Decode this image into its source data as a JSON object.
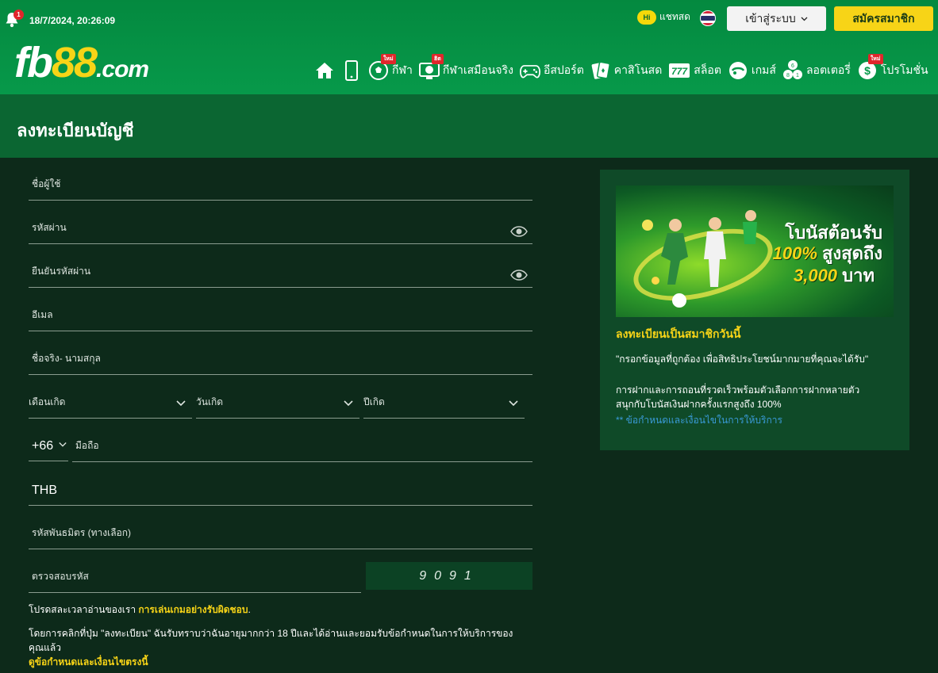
{
  "header": {
    "notification_count": "1",
    "datetime": "18/7/2024, 20:26:09",
    "chat_badge": "Hi",
    "chat_label": "แชทสด",
    "login_label": "เข้าสู่ระบบ",
    "register_label": "สมัครสมาชิก",
    "logo": {
      "part1": "fb",
      "part2": "88",
      "part3": ".com"
    },
    "nav": [
      {
        "icon": "home-icon",
        "label": "",
        "badge": ""
      },
      {
        "icon": "mobile-icon",
        "label": "",
        "badge": ""
      },
      {
        "icon": "soccer-ball-icon",
        "label": "กีฬา",
        "badge": "ใหม่"
      },
      {
        "icon": "virtual-sports-icon",
        "label": "กีฬาเสมือนจริง",
        "badge": "ฮิต"
      },
      {
        "icon": "gamepad-icon",
        "label": "อีสปอร์ต",
        "badge": ""
      },
      {
        "icon": "cards-icon",
        "label": "คาสิโนสด",
        "badge": ""
      },
      {
        "icon": "slot-777-icon",
        "label": "สล็อต",
        "badge": ""
      },
      {
        "icon": "game-icon",
        "label": "เกมส์",
        "badge": ""
      },
      {
        "icon": "lottery-balls-icon",
        "label": "ลอตเตอรี่",
        "badge": ""
      },
      {
        "icon": "promo-dollar-icon",
        "label": "โปรโมชั่น",
        "badge": "ใหม่"
      }
    ]
  },
  "page_title": "ลงทะเบียนบัญชี",
  "form": {
    "username_placeholder": "ชื่อผู้ใช้",
    "password_placeholder": "รหัสผ่าน",
    "confirm_password_placeholder": "ยืนยันรหัสผ่าน",
    "email_placeholder": "อีเมล",
    "fullname_placeholder": "ชื่อจริง- นามสกุล",
    "birth_month_label": "เดือนเกิด",
    "birth_day_label": "วันเกิด",
    "birth_year_label": "ปีเกิด",
    "phone_code": "+66",
    "phone_placeholder": "มือถือ",
    "currency": "THB",
    "referral_placeholder": "รหัสพันธมิตร (ทางเลือก)",
    "captcha_label": "ตรวจสอบรหัส",
    "captcha_code": "9091",
    "note1_prefix": "โปรดสละเวลาอ่านของเรา ",
    "note1_link": "การเล่นเกมอย่างรับผิดชอบ",
    "note1_suffix": ".",
    "note2_line1": "โดยการคลิกที่ปุ่ม \"ลงทะเบียน\" ฉันรับทราบว่าฉันอายุมากกว่า 18 ปีและได้อ่านและยอมรับข้อกำหนดในการให้บริการของ",
    "note2_line2": "คุณแล้ว",
    "note2_link": "ดูข้อกำหนดและเงื่อนไขตรงนี้"
  },
  "panel": {
    "banner_line1": "โบนัสต้อนรับ",
    "banner_line2_pct": "100%",
    "banner_line2_text": "สูงสุดถึง",
    "banner_line3_amount": "3,000",
    "banner_line3_unit": "บาท",
    "title": "ลงทะเบียนเป็นสมาชิกวันนี้",
    "quote": "\"กรอกข้อมูลที่ถูกต้อง เพื่อสิทธิประโยชน์มากมายที่คุณจะได้รับ\"",
    "text_line1": "การฝากและการถอนที่รวดเร็วพร้อมตัวเลือกการฝากหลายตัว",
    "text_line2": "สนุกกับโบนัสเงินฝากครั้งแรกสูงถึง 100%",
    "terms_link": "** ข้อกำหนดและเงื่อนไขในการให้บริการ"
  },
  "colors": {
    "brand_green": "#07994a",
    "accent_yellow": "#f7d417",
    "bg_dark": "#0d2a1a",
    "link_blue": "#3a9bd9"
  }
}
